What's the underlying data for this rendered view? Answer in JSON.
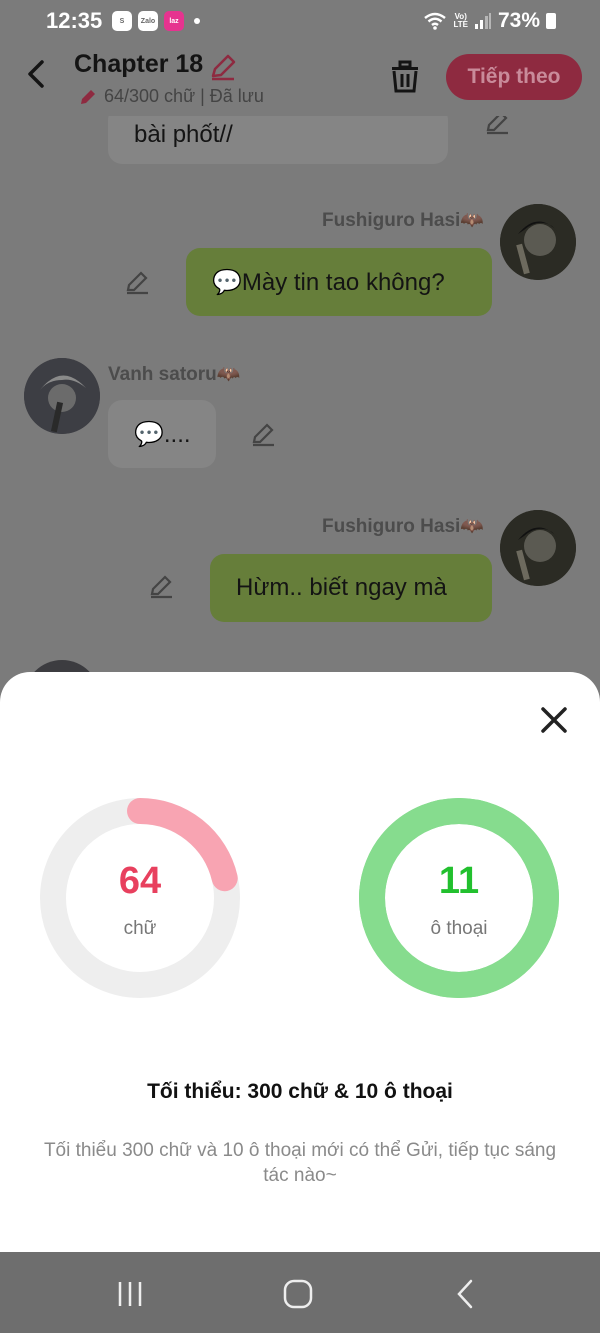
{
  "status": {
    "time": "12:35",
    "apps": [
      "S",
      "Zalo",
      "Lazada"
    ],
    "battery": "73%",
    "network": "LTE"
  },
  "header": {
    "title": "Chapter 18",
    "meta": "64/300 chữ | Đã lưu",
    "next_label": "Tiếp theo"
  },
  "chat": {
    "messages": [
      {
        "text": "bài phốt//"
      },
      {
        "sender": "Fushiguro Hasi🦇",
        "text": "💬Mày tin tao không?"
      },
      {
        "sender": "Vanh satoru🦇",
        "text": "💬...."
      },
      {
        "sender": "Fushiguro Hasi🦇",
        "text": "Hừm.. biết ngay mà"
      }
    ]
  },
  "stats": {
    "words": {
      "value": "64",
      "label": "chữ",
      "progress": 0.2133,
      "color": "#f85c78"
    },
    "dialogues": {
      "value": "11",
      "label": "ô thoại",
      "progress": 1.0,
      "color": "#22c02e"
    },
    "min_title": "Tối thiểu: 300 chữ & 10 ô thoại",
    "min_desc": "Tối thiểu 300 chữ và 10 ô thoại mới có thể Gửi, tiếp tục sáng tác nào~"
  },
  "colors": {
    "accent": "#e8405e",
    "words_ring": "#f8a4b2",
    "dialogue_ring": "#86dc8e",
    "ring_track": "#eeeeee"
  }
}
